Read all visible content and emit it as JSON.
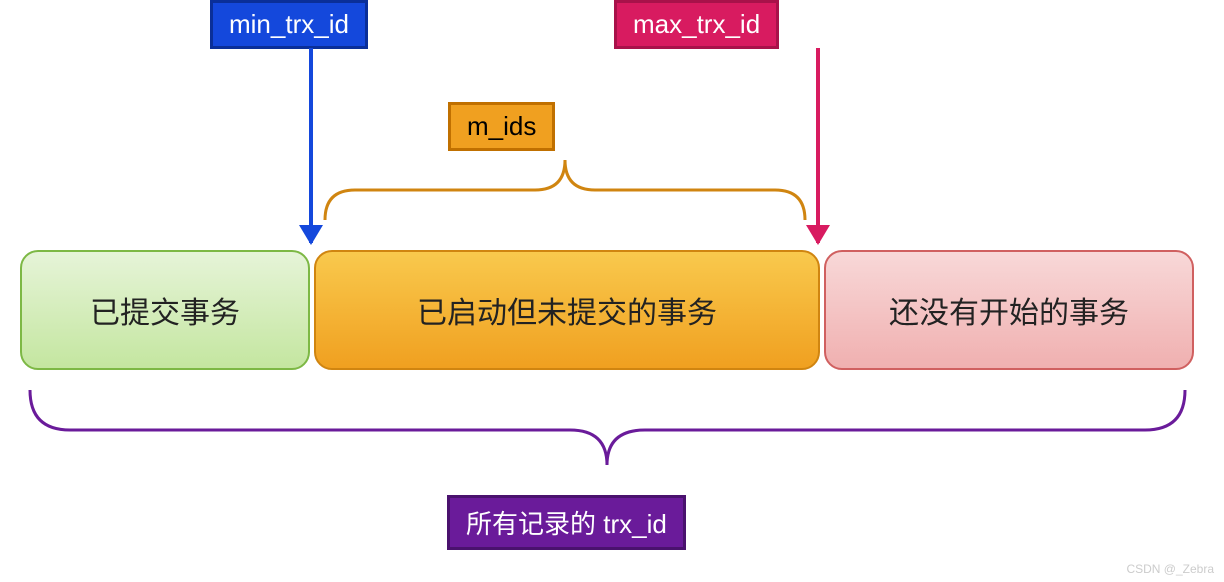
{
  "labels": {
    "min_trx": "min_trx_id",
    "max_trx": "max_trx_id",
    "m_ids": "m_ids",
    "all_trx": "所有记录的 trx_id"
  },
  "boxes": {
    "committed": "已提交事务",
    "active": "已启动但未提交的事务",
    "not_started": "还没有开始的事务"
  },
  "colors": {
    "blue": "#1448dc",
    "pink": "#d81b60",
    "orange": "#f0a020",
    "purple": "#6a1b9a",
    "green_box": "#c4e6a0",
    "brace_orange": "#d08510",
    "brace_purple": "#6a1b9a"
  },
  "watermark": "CSDN @_Zebra"
}
